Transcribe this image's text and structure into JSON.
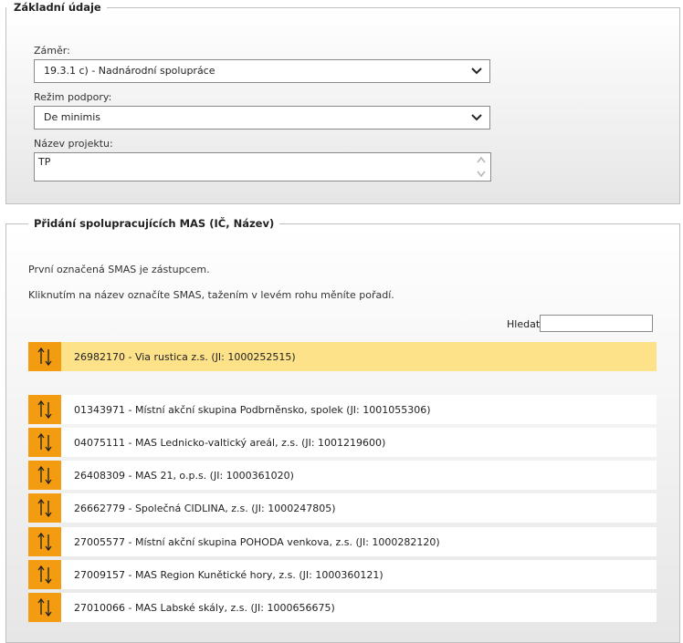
{
  "basic": {
    "legend": "Základní údaje",
    "zamer_label": "Záměr:",
    "zamer_value": "19.3.1 c) - Nadnárodní spolupráce",
    "rezim_label": "Režim podpory:",
    "rezim_value": "De minimis",
    "nazev_label": "Název projektu:",
    "nazev_value": "TP"
  },
  "mas": {
    "legend": "Přidání spolupracujících MAS (IČ, Název)",
    "info1": "První označená SMAS je zástupcem.",
    "info2": "Kliknutím na název označíte SMAS, tažením v levém rohu měníte pořadí.",
    "search_label": "Hledat:",
    "search_value": "",
    "selected": [
      {
        "label": "26982170 - Via rustica z.s. (JI: 1000252515)"
      }
    ],
    "items": [
      {
        "label": "01343971 - Místní akční skupina Podbrněnsko, spolek (JI: 1001055306)"
      },
      {
        "label": "04075111 - MAS Lednicko-valtický areál, z.s. (JI: 1001219600)"
      },
      {
        "label": "26408309 - MAS 21, o.p.s. (JI: 1000361020)"
      },
      {
        "label": "26662779 - Společná CIDLINA, z.s. (JI: 1000247805)"
      },
      {
        "label": "27005577 - Místní akční skupina POHODA venkova, z.s. (JI: 1000282120)"
      },
      {
        "label": "27009157 - MAS Region Kunětické hory, z.s. (JI: 1000360121)"
      },
      {
        "label": "27010066 - MAS Labské skály, z.s. (JI: 1000656675)"
      }
    ]
  },
  "colors": {
    "handle": "#f39c12",
    "selected_row": "#fde28a"
  }
}
